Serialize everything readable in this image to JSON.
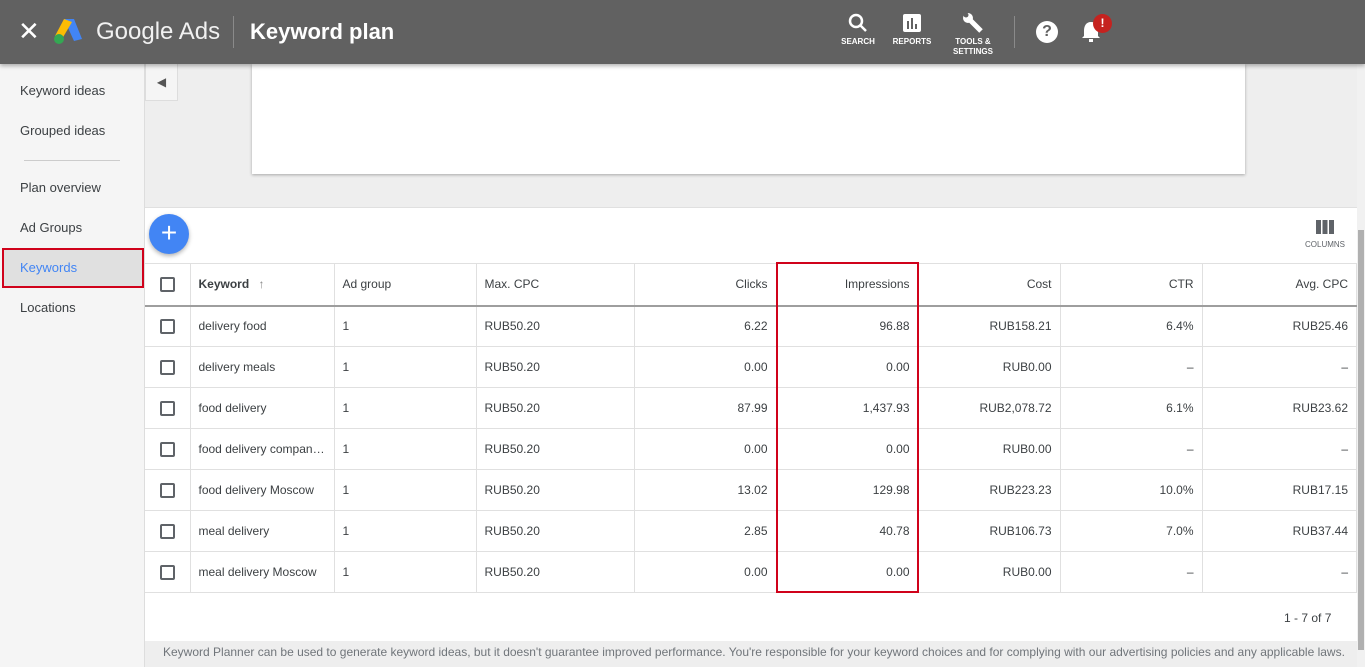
{
  "header": {
    "app_name": "Google Ads",
    "page_title": "Keyword plan",
    "search_label": "SEARCH",
    "reports_label": "REPORTS",
    "tools_label_1": "TOOLS &",
    "tools_label_2": "SETTINGS",
    "notification_badge": "!"
  },
  "sidebar": {
    "items": [
      {
        "label": "Keyword ideas"
      },
      {
        "label": "Grouped ideas"
      },
      {
        "label": "Plan overview"
      },
      {
        "label": "Ad Groups"
      },
      {
        "label": "Keywords",
        "active": true
      },
      {
        "label": "Locations"
      }
    ]
  },
  "toolbar": {
    "columns_label": "COLUMNS"
  },
  "table": {
    "columns": [
      "Keyword",
      "Ad group",
      "Max. CPC",
      "Clicks",
      "Impressions",
      "Cost",
      "CTR",
      "Avg. CPC"
    ],
    "rows": [
      [
        "delivery food",
        "1",
        "RUB50.20",
        "6.22",
        "96.88",
        "RUB158.21",
        "6.4%",
        "RUB25.46"
      ],
      [
        "delivery meals",
        "1",
        "RUB50.20",
        "0.00",
        "0.00",
        "RUB0.00",
        "–",
        "–"
      ],
      [
        "food delivery",
        "1",
        "RUB50.20",
        "87.99",
        "1,437.93",
        "RUB2,078.72",
        "6.1%",
        "RUB23.62"
      ],
      [
        "food delivery compan…",
        "1",
        "RUB50.20",
        "0.00",
        "0.00",
        "RUB0.00",
        "–",
        "–"
      ],
      [
        "food delivery Moscow",
        "1",
        "RUB50.20",
        "13.02",
        "129.98",
        "RUB223.23",
        "10.0%",
        "RUB17.15"
      ],
      [
        "meal delivery",
        "1",
        "RUB50.20",
        "2.85",
        "40.78",
        "RUB106.73",
        "7.0%",
        "RUB37.44"
      ],
      [
        "meal delivery Moscow",
        "1",
        "RUB50.20",
        "0.00",
        "0.00",
        "RUB0.00",
        "–",
        "–"
      ]
    ],
    "pagination": "1 - 7 of 7"
  },
  "disclaimer": "Keyword Planner can be used to generate keyword ideas, but it doesn't guarantee improved performance. You're responsible for your keyword choices and for complying with our advertising policies and any applicable laws.",
  "colors": {
    "header": "#616161",
    "accent": "#4285f4",
    "highlight": "#d0021b"
  }
}
